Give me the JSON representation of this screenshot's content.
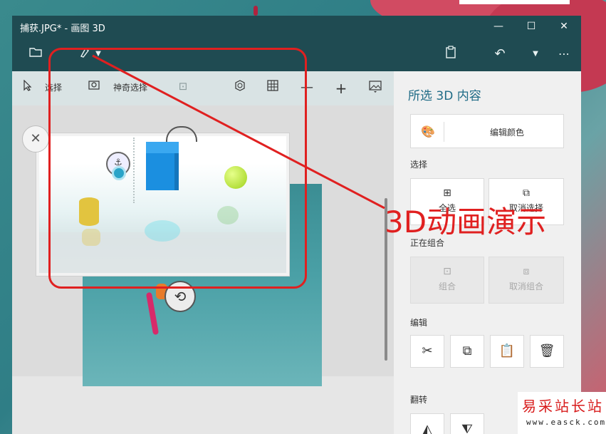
{
  "window": {
    "title": "捕获.JPG* - 画图 3D",
    "minimize_glyph": "—",
    "maximize_glyph": "☐",
    "close_glyph": "✕"
  },
  "appbar": {
    "icons": [
      "folder-icon",
      "brush-icon",
      "dropdown-icon",
      "paste-icon",
      "undo-icon",
      "history-dropdown-icon",
      "more-icon"
    ]
  },
  "toolbar": {
    "select_label": "选择",
    "magic_select_label": "神奇选择"
  },
  "panel": {
    "title": "所选 3D 内容",
    "edit_color_label": "编辑颜色",
    "select_section": "选择",
    "select_all_label": "全选",
    "deselect_label": "取消选择",
    "group_section": "正在组合",
    "group_label": "组合",
    "ungroup_label": "取消组合",
    "edit_section": "编辑",
    "flip_section": "翻转"
  },
  "annotation": {
    "text": "3D动画演示",
    "color": "#e02020"
  },
  "watermark": {
    "chinese": "易采站长站",
    "url": "www.easck.com"
  },
  "colors": {
    "titlebar": "#1f4b52",
    "accent": "#1f6b86"
  }
}
